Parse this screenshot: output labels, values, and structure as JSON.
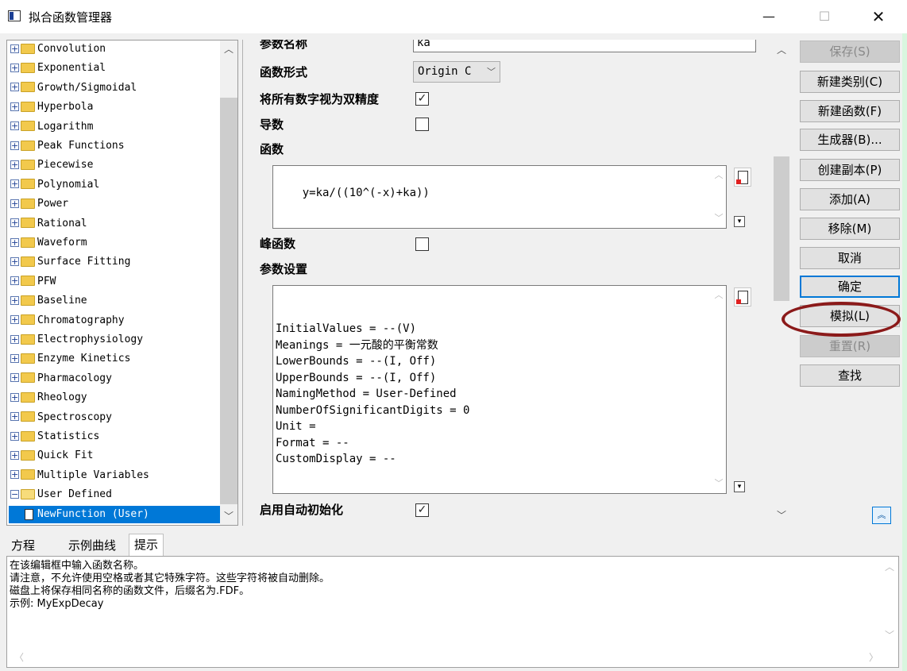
{
  "window": {
    "title": "拟合函数管理器",
    "min_glyph": "—",
    "max_glyph": "☐",
    "close_glyph": "✕"
  },
  "tree": {
    "items": [
      {
        "label": "Convolution",
        "expander": "+"
      },
      {
        "label": "Exponential",
        "expander": "+"
      },
      {
        "label": "Growth/Sigmoidal",
        "expander": "+"
      },
      {
        "label": "Hyperbola",
        "expander": "+"
      },
      {
        "label": "Logarithm",
        "expander": "+"
      },
      {
        "label": "Peak Functions",
        "expander": "+"
      },
      {
        "label": "Piecewise",
        "expander": "+"
      },
      {
        "label": "Polynomial",
        "expander": "+"
      },
      {
        "label": "Power",
        "expander": "+"
      },
      {
        "label": "Rational",
        "expander": "+"
      },
      {
        "label": "Waveform",
        "expander": "+"
      },
      {
        "label": "Surface Fitting",
        "expander": "+"
      },
      {
        "label": "PFW",
        "expander": "+"
      },
      {
        "label": "Baseline",
        "expander": "+"
      },
      {
        "label": "Chromatography",
        "expander": "+"
      },
      {
        "label": "Electrophysiology",
        "expander": "+"
      },
      {
        "label": "Enzyme Kinetics",
        "expander": "+"
      },
      {
        "label": "Pharmacology",
        "expander": "+"
      },
      {
        "label": "Rheology",
        "expander": "+"
      },
      {
        "label": "Spectroscopy",
        "expander": "+"
      },
      {
        "label": "Statistics",
        "expander": "+"
      },
      {
        "label": "Quick Fit",
        "expander": "+"
      },
      {
        "label": "Multiple Variables",
        "expander": "+"
      },
      {
        "label": "User Defined",
        "expander": "−"
      }
    ],
    "selected": "NewFunction (User)"
  },
  "settings": {
    "param_names_label": "参数名称",
    "param_names_value": "ka",
    "function_form_label": "函数形式",
    "function_form_value": "Origin C",
    "double_precision_label": "将所有数字视为双精度",
    "double_precision_checked": true,
    "derivative_label": "导数",
    "derivative_checked": false,
    "function_label": "函数",
    "function_value": "y=ka/((10^(-x)+ka))",
    "peak_function_label": "峰函数",
    "peak_function_checked": false,
    "param_settings_label": "参数设置",
    "param_settings_lines": [
      "InitialValues = --(V)",
      "Meanings = 一元酸的平衡常数",
      "LowerBounds = --(I, Off)",
      "UpperBounds = --(I, Off)",
      "NamingMethod = User-Defined",
      "NumberOfSignificantDigits = 0",
      "Unit =",
      "Format = --",
      "CustomDisplay = --"
    ],
    "auto_init_label": "启用自动初始化",
    "auto_init_checked": true
  },
  "buttons": {
    "save": "保存(S)",
    "new_category": "新建类别(C)",
    "new_function": "新建函数(F)",
    "generator": "生成器(B)...",
    "duplicate": "创建副本(P)",
    "add": "添加(A)",
    "remove": "移除(M)",
    "cancel": "取消",
    "ok": "确定",
    "simulate": "模拟(L)",
    "reset": "重置(R)",
    "find": "查找"
  },
  "tabs": [
    "方程",
    "示例曲线",
    "提示"
  ],
  "active_tab": "提示",
  "info_lines": [
    "在该编辑框中输入函数名称。",
    "请注意，不允许使用空格或者其它特殊字符。这些字符将被自动删除。",
    "磁盘上将保存相同名称的函数文件，后缀名为.FDF。",
    "示例: MyExpDecay"
  ],
  "colors": {
    "selection": "#0078d7",
    "highlight_ellipse": "#8b1a1a"
  }
}
